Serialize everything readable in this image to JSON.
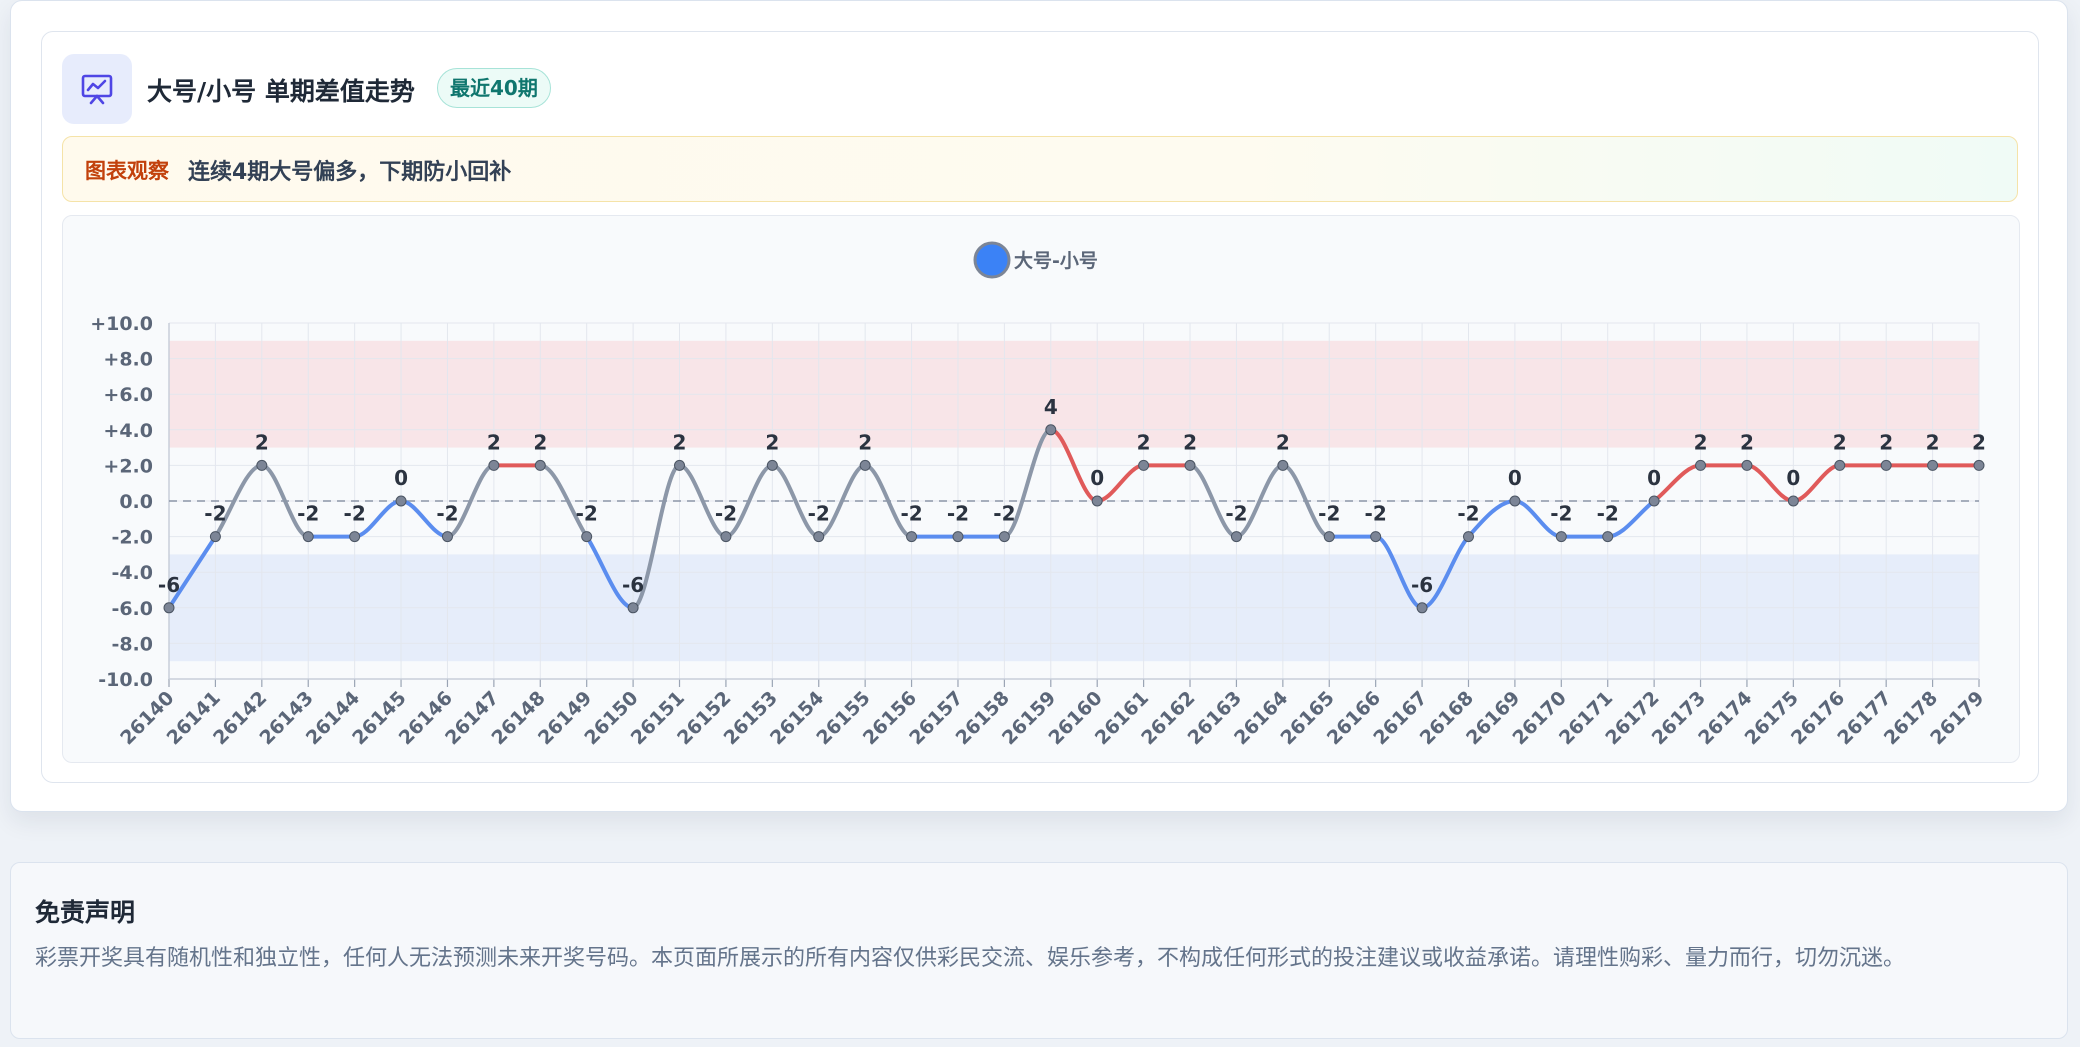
{
  "header": {
    "title": "大号/小号 单期差值走势",
    "badge": "最近40期"
  },
  "insight": {
    "label": "图表观察",
    "text": "连续4期大号偏多，下期防小回补"
  },
  "colors": {
    "positive": "#e05a5a",
    "negative": "#5b8def",
    "neutral": "#8c97a8",
    "legend_dot": "#3b82f6",
    "upper_band": "#f8e5e8",
    "lower_band": "#e6edfa"
  },
  "chart_data": {
    "type": "line",
    "legend": "大号-小号",
    "legend_position": "top-center",
    "x": [
      "26140",
      "26141",
      "26142",
      "26143",
      "26144",
      "26145",
      "26146",
      "26147",
      "26148",
      "26149",
      "26150",
      "26151",
      "26152",
      "26153",
      "26154",
      "26155",
      "26156",
      "26157",
      "26158",
      "26159",
      "26160",
      "26161",
      "26162",
      "26163",
      "26164",
      "26165",
      "26166",
      "26167",
      "26168",
      "26169",
      "26170",
      "26171",
      "26172",
      "26173",
      "26174",
      "26175",
      "26176",
      "26177",
      "26178",
      "26179"
    ],
    "values": [
      -6,
      -2,
      2,
      -2,
      -2,
      0,
      -2,
      2,
      2,
      -2,
      -6,
      2,
      -2,
      2,
      -2,
      2,
      -2,
      -2,
      -2,
      4,
      0,
      2,
      2,
      -2,
      2,
      -2,
      -2,
      -6,
      -2,
      0,
      -2,
      -2,
      0,
      2,
      2,
      0,
      2,
      2,
      2,
      2
    ],
    "ylim": [
      -10,
      10
    ],
    "yticks": [
      "+10.0",
      "+8.0",
      "+6.0",
      "+4.0",
      "+2.0",
      "0.0",
      "-2.0",
      "-4.0",
      "-6.0",
      "-8.0",
      "-10.0"
    ],
    "ytick_values": [
      10,
      8,
      6,
      4,
      2,
      0,
      -2,
      -4,
      -6,
      -8,
      -10
    ],
    "upper_band": [
      3,
      9
    ],
    "lower_band": [
      -9,
      -3
    ],
    "zero_line": true,
    "grid": true
  },
  "disclaimer": {
    "title": "免责声明",
    "text": "彩票开奖具有随机性和独立性，任何人无法预测未来开奖号码。本页面所展示的所有内容仅供彩民交流、娱乐参考，不构成任何形式的投注建议或收益承诺。请理性购彩、量力而行，切勿沉迷。"
  }
}
